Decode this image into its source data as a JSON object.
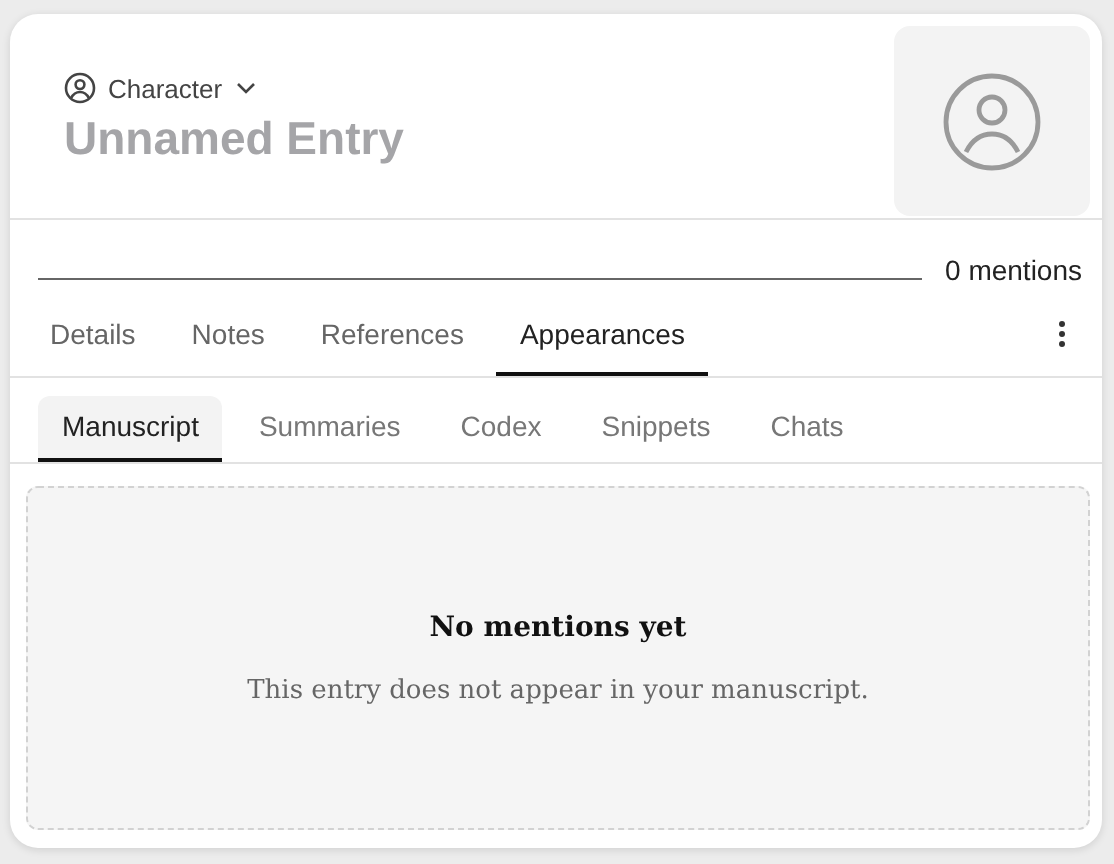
{
  "entry": {
    "type_label": "Character",
    "title": "Unnamed Entry"
  },
  "mentions": {
    "count": "0 mentions"
  },
  "tabs": [
    {
      "label": "Details",
      "selected": false
    },
    {
      "label": "Notes",
      "selected": false
    },
    {
      "label": "References",
      "selected": false
    },
    {
      "label": "Appearances",
      "selected": true
    }
  ],
  "sub_tabs": [
    {
      "label": "Manuscript",
      "selected": true
    },
    {
      "label": "Summaries",
      "selected": false
    },
    {
      "label": "Codex",
      "selected": false
    },
    {
      "label": "Snippets",
      "selected": false
    },
    {
      "label": "Chats",
      "selected": false
    }
  ],
  "empty_state": {
    "heading": "No mentions yet",
    "message": "This entry does not appear in your manuscript."
  }
}
